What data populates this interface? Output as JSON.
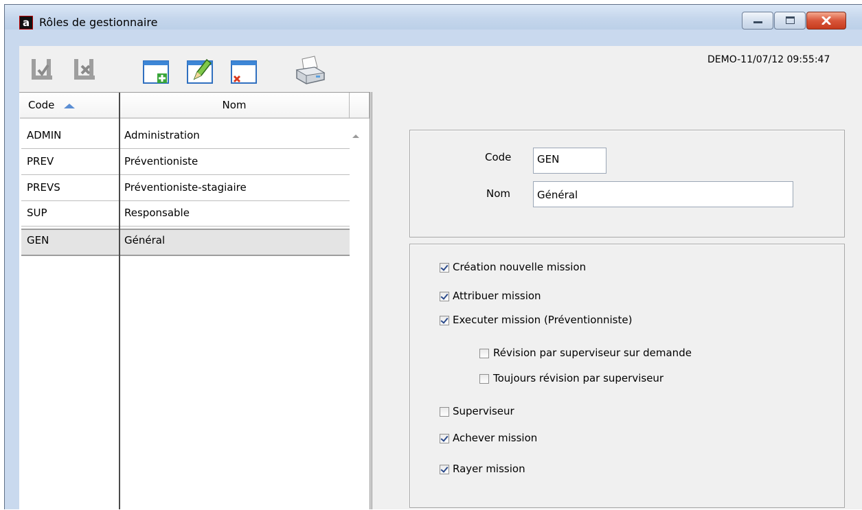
{
  "window": {
    "title": "Rôles de gestionnaire",
    "logo_letter": "a"
  },
  "toolbar": {
    "timestamp": "DEMO-11/07/12 09:55:47",
    "icons": [
      "save-check-icon",
      "save-cancel-icon",
      "new-record-icon",
      "edit-record-icon",
      "delete-record-icon",
      "print-icon"
    ]
  },
  "grid": {
    "columns": [
      "Code",
      "Nom"
    ],
    "sort_column": "Code",
    "rows": [
      {
        "code": "ADMIN",
        "nom": "Administration"
      },
      {
        "code": "PREV",
        "nom": "Préventioniste"
      },
      {
        "code": "PREVS",
        "nom": "Préventioniste-stagiaire"
      },
      {
        "code": "SUP",
        "nom": "Responsable"
      },
      {
        "code": "GEN",
        "nom": "Général"
      }
    ],
    "selected_index": 4
  },
  "form": {
    "code_label": "Code",
    "code_value": "GEN",
    "nom_label": "Nom",
    "nom_value": "Général"
  },
  "permissions": [
    {
      "label": "Création nouvelle mission",
      "checked": true
    },
    {
      "label": "Attribuer mission",
      "checked": true
    },
    {
      "label": "Executer mission (Préventionniste)",
      "checked": true
    },
    {
      "label": "Révision par superviseur sur demande",
      "checked": false
    },
    {
      "label": "Toujours révision par superviseur",
      "checked": false
    },
    {
      "label": "Superviseur",
      "checked": false
    },
    {
      "label": "Achever mission",
      "checked": true
    },
    {
      "label": "Rayer mission",
      "checked": true
    }
  ]
}
